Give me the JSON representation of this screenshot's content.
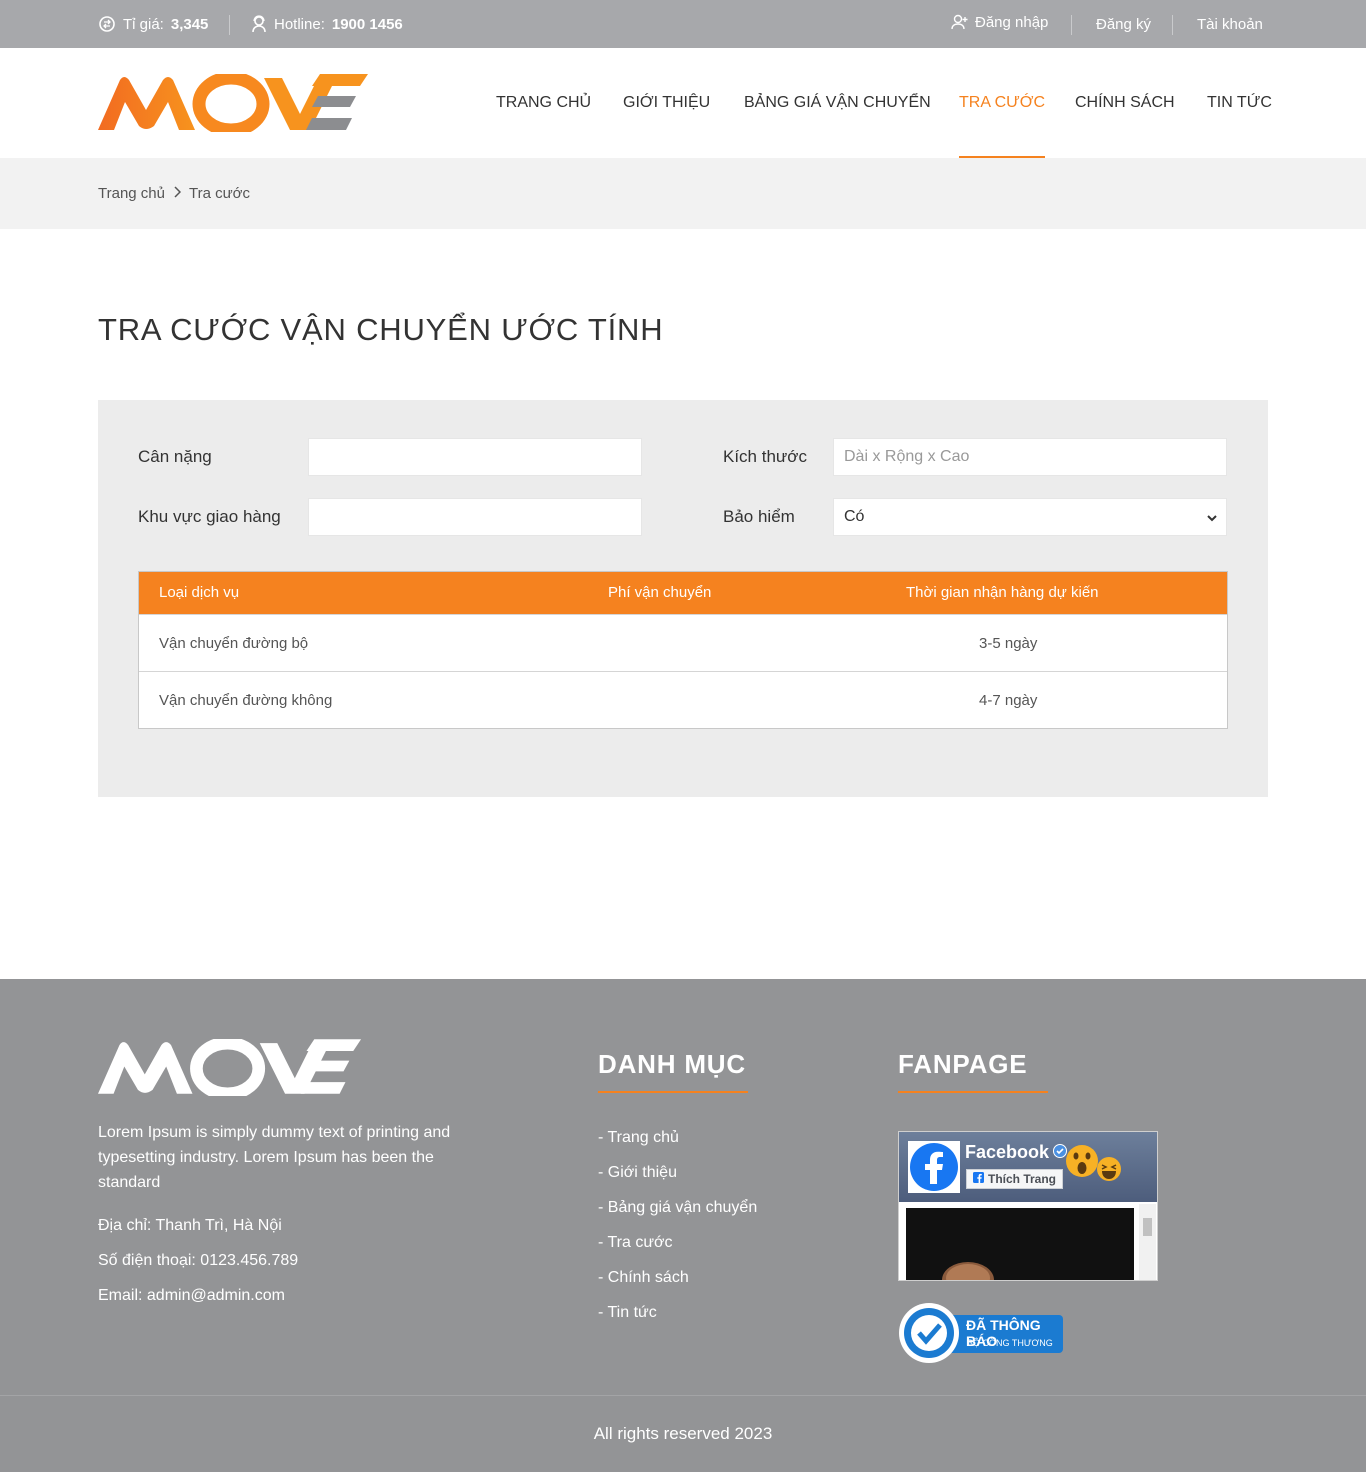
{
  "topbar": {
    "rate_label": "Tỉ giá:",
    "rate_value": "3,345",
    "hotline_label": "Hotline:",
    "hotline_value": "1900 1456",
    "login": "Đăng nhập",
    "register": "Đăng ký",
    "account": "Tài khoản"
  },
  "header": {
    "logo_text": "MOVE",
    "nav": [
      {
        "label": "TRANG CHỦ",
        "active": false
      },
      {
        "label": "GIỚI THIỆU",
        "active": false
      },
      {
        "label": "BẢNG GIÁ VẬN CHUYỂN",
        "active": false
      },
      {
        "label": "TRA CƯỚC",
        "active": true
      },
      {
        "label": "CHÍNH SÁCH",
        "active": false
      },
      {
        "label": "TIN TỨC",
        "active": false
      }
    ]
  },
  "breadcrumb": {
    "home": "Trang chủ",
    "current": "Tra cước"
  },
  "main": {
    "title": "TRA CƯỚC VẬN CHUYỂN ƯỚC TÍNH",
    "form": {
      "weight_label": "Cân nặng",
      "weight_value": "",
      "size_label": "Kích thước",
      "size_placeholder": "Dài x Rộng x Cao",
      "area_label": "Khu vực giao hàng",
      "area_value": "",
      "insurance_label": "Bảo hiểm",
      "insurance_selected": "Có"
    },
    "table": {
      "headers": [
        "Loại dịch vụ",
        "Phí vận chuyển",
        "Thời gian nhận hàng dự kiến"
      ],
      "rows": [
        {
          "service": "Vận chuyển đường bộ",
          "fee": "",
          "time": "3-5 ngày"
        },
        {
          "service": "Vận chuyển đường không",
          "fee": "",
          "time": "4-7 ngày"
        }
      ]
    }
  },
  "footer": {
    "about": "Lorem Ipsum is simply dummy text of printing and typesetting industry. Lorem Ipsum has been the standard",
    "address": "Địa chỉ: Thanh Trì, Hà Nội",
    "phone": "Số điện thoại: 0123.456.789",
    "email": "Email: admin@admin.com",
    "menu_heading": "DANH MỤC",
    "menu": [
      "- Trang chủ",
      "- Giới thiệu",
      "- Bảng giá vận chuyển",
      "- Tra cước",
      "- Chính sách",
      "- Tin tức"
    ],
    "fanpage_heading": "FANPAGE",
    "fb_name": "Facebook",
    "fb_like": "Thích Trang",
    "badge_line1": "ĐÃ THÔNG BÁO",
    "badge_line2": "BỘ CÔNG THƯƠNG",
    "copyright": "All rights reserved 2023"
  },
  "colors": {
    "accent": "#f5821f",
    "topbar_bg": "#a7a8ab",
    "footer_bg": "#939496"
  }
}
